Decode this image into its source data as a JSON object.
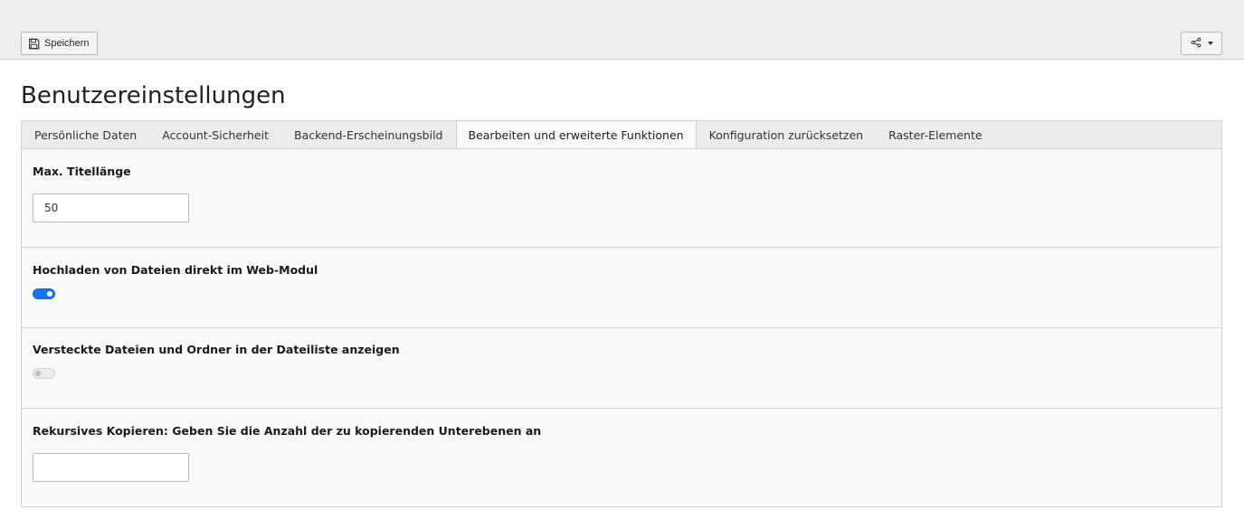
{
  "toolbar": {
    "save_label": "Speichern",
    "save_icon": "floppy-disk-icon",
    "share_icon": "share-icon"
  },
  "page": {
    "title": "Benutzereinstellungen"
  },
  "tabs": [
    {
      "label": "Persönliche Daten",
      "active": false
    },
    {
      "label": "Account-Sicherheit",
      "active": false
    },
    {
      "label": "Backend-Erscheinungsbild",
      "active": false
    },
    {
      "label": "Bearbeiten und erweiterte Funktionen",
      "active": true
    },
    {
      "label": "Konfiguration zurücksetzen",
      "active": false
    },
    {
      "label": "Raster-Elemente",
      "active": false
    }
  ],
  "settings": {
    "title_length": {
      "label": "Max. Titellänge",
      "value": "50"
    },
    "upload_direct": {
      "label": "Hochladen von Dateien direkt im Web-Modul",
      "enabled": true
    },
    "show_hidden": {
      "label": "Versteckte Dateien und Ordner in der Dateiliste anzeigen",
      "enabled": false
    },
    "recursive_copy": {
      "label": "Rekursives Kopieren: Geben Sie die Anzahl der zu kopierenden Unterebenen an",
      "value": ""
    }
  },
  "colors": {
    "accent": "#1a73e8",
    "toolbar_bg": "#eeeeee",
    "panel_bg": "#f9f9f9"
  }
}
